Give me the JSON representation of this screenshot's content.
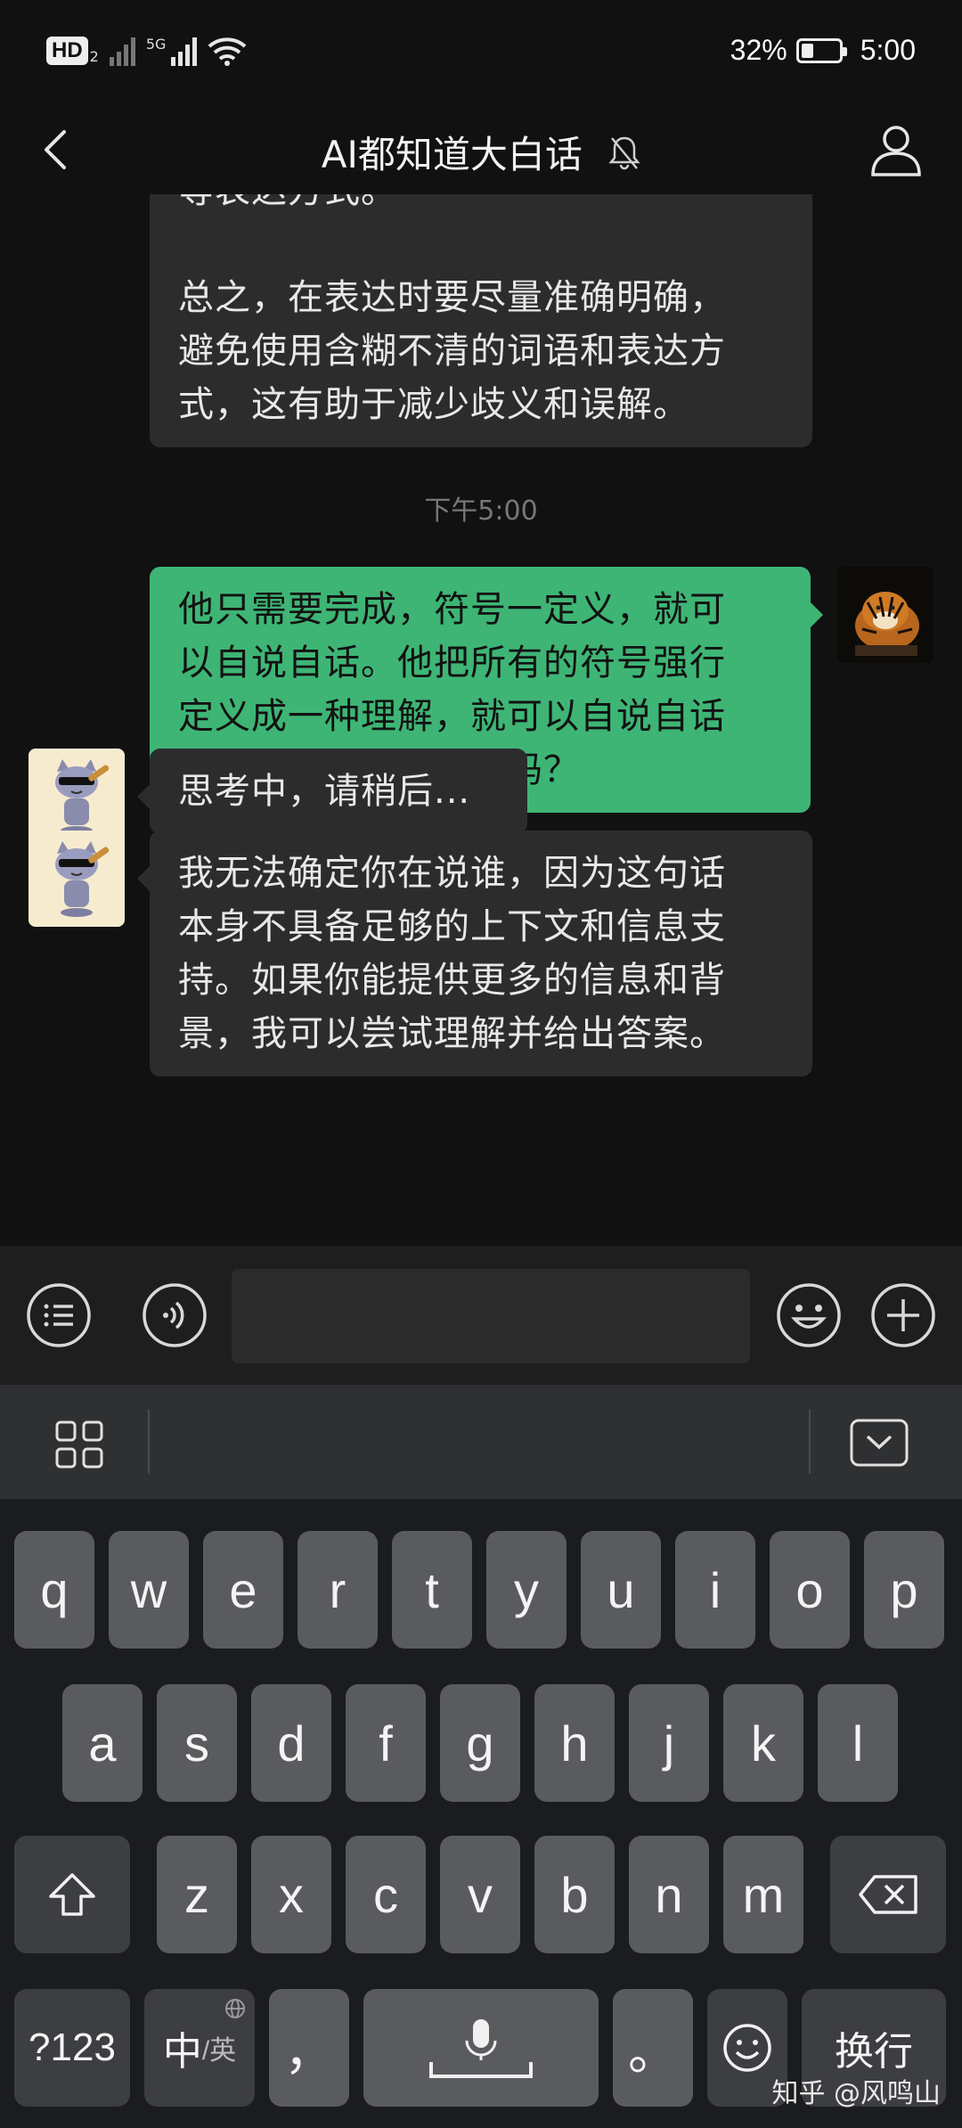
{
  "status_bar": {
    "network_badge": "HD",
    "network_badge_sub": "2",
    "sim2_label": "5G",
    "battery_percent": "32%",
    "battery_level": 0.32,
    "time": "5:00"
  },
  "header": {
    "title": "AI都知道大白话",
    "back_icon": "chevron-left-icon",
    "mute_icon": "bell-off-icon",
    "profile_icon": "person-icon"
  },
  "chat": {
    "messages": [
      {
        "side": "left",
        "text_lines": [
          "等表达方式。",
          "",
          "总之，在表达时要尽量准确明确，",
          "避免使用含糊不清的词语和表达方",
          "式，这有助于减少歧义和误解。"
        ]
      },
      {
        "type": "timestamp",
        "text": "下午5:00"
      },
      {
        "side": "right",
        "text_lines": [
          "他只需要完成，符号一定义，就可",
          "以自说自话。他把所有的符号强行",
          "定义成一种理解，就可以自说自话",
          "了。知道我说的是谁吗？"
        ]
      },
      {
        "side": "left",
        "text_lines": [
          "思考中，请稍后..."
        ]
      },
      {
        "side": "left",
        "text_lines": [
          "我无法确定你在说谁，因为这句话",
          "本身不具备足够的上下文和信息支",
          "持。如果你能提供更多的信息和背",
          "景，我可以尝试理解并给出答案。"
        ]
      }
    ]
  },
  "input_bar": {
    "menu_icon": "list-icon",
    "voice_icon": "voice-icon",
    "emoji_icon": "smiley-icon",
    "plus_icon": "plus-icon",
    "text_value": ""
  },
  "keyboard": {
    "row1": [
      "q",
      "w",
      "e",
      "r",
      "t",
      "y",
      "u",
      "i",
      "o",
      "p"
    ],
    "row2": [
      "a",
      "s",
      "d",
      "f",
      "g",
      "h",
      "j",
      "k",
      "l"
    ],
    "row3": [
      "z",
      "x",
      "c",
      "v",
      "b",
      "n",
      "m"
    ],
    "num_key": "?123",
    "lang_key_main": "中",
    "lang_key_sub": "/英",
    "comma_key": "，",
    "period_key": "。",
    "enter_key": "换行"
  },
  "watermark": "知乎 @风鸣山"
}
